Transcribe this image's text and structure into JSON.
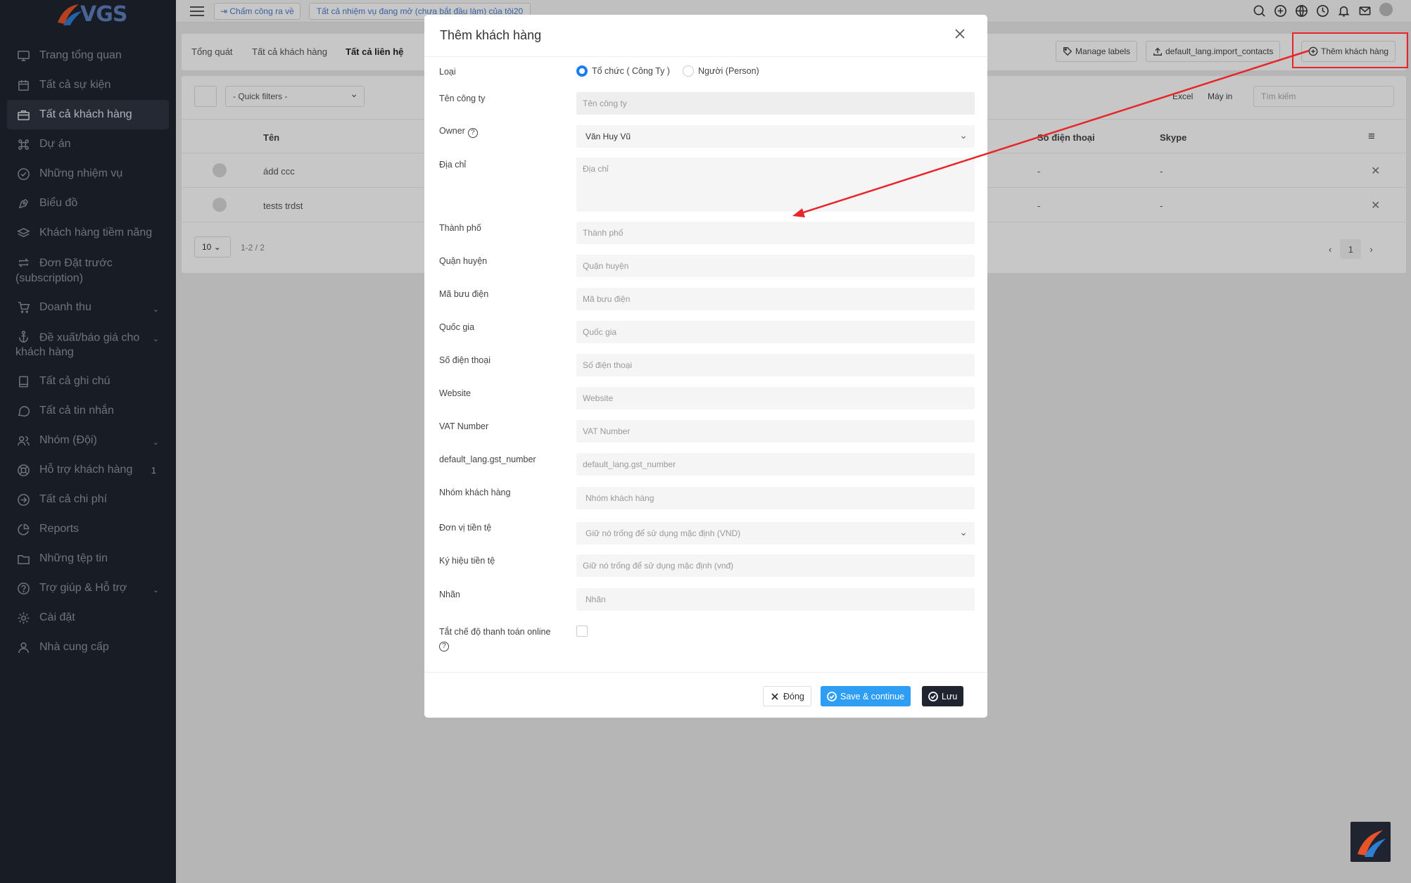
{
  "app": {
    "logo_text": "VGS"
  },
  "sidebar": {
    "items": [
      {
        "label": "Trang tổng quan",
        "icon": "monitor-icon"
      },
      {
        "label": "Tất cả sự kiện",
        "icon": "calendar-icon"
      },
      {
        "label": "Tất cả khách hàng",
        "icon": "briefcase-icon",
        "active": true
      },
      {
        "label": "Dự án",
        "icon": "command-icon"
      },
      {
        "label": "Những nhiệm vụ",
        "icon": "check-circle-icon"
      },
      {
        "label": "Biểu đồ",
        "icon": "pen-tool-icon"
      },
      {
        "label": "Khách hàng tiềm năng",
        "icon": "layers-icon"
      },
      {
        "label": "Đơn Đặt trước (subscription)",
        "icon": "repeat-icon"
      },
      {
        "label": "Doanh thu",
        "icon": "cart-icon",
        "chevron": true
      },
      {
        "label": "Đề xuất/báo giá cho khách hàng",
        "icon": "anchor-icon",
        "chevron": true
      },
      {
        "label": "Tất cả ghi chú",
        "icon": "book-icon"
      },
      {
        "label": "Tất cả tin nhắn",
        "icon": "message-circle-icon"
      },
      {
        "label": "Nhóm (Đội)",
        "icon": "users-icon",
        "chevron": true
      },
      {
        "label": "Hỗ trợ khách hàng",
        "icon": "life-buoy-icon",
        "badge": "1"
      },
      {
        "label": "Tất cả chi phí",
        "icon": "arrow-right-circle-icon"
      },
      {
        "label": "Reports",
        "icon": "pie-chart-icon"
      },
      {
        "label": "Những tệp tin",
        "icon": "folder-icon"
      },
      {
        "label": "Trợ giúp & Hỗ trợ",
        "icon": "help-circle-icon",
        "chevron": true
      },
      {
        "label": "Cài đặt",
        "icon": "settings-icon"
      },
      {
        "label": "Nhà cung cấp",
        "icon": "user-icon"
      }
    ]
  },
  "topbar": {
    "clock_out": "Chấm công ra về",
    "tasks_notice": "Tất cả nhiệm vụ đang mở (chưa bắt đầu làm) của tôi20"
  },
  "page": {
    "tabs": [
      "Tổng quát",
      "Tất cả khách hàng",
      "Tất cả liên hệ"
    ],
    "active_tab": "Tất cả liên hệ",
    "manage_labels": "Manage labels",
    "import_contacts": "default_lang.import_contacts",
    "add_client": "Thêm khách hàng",
    "quick_filters": "- Quick filters -",
    "excel": "Excel",
    "print": "Máy in",
    "search_placeholder": "Tìm kiếm",
    "columns": {
      "name": "Tên",
      "phone": "Số điện thoại",
      "skype": "Skype"
    },
    "rows": [
      {
        "name": "ádd ccc",
        "phone": "-",
        "skype": "-"
      },
      {
        "name": "tests trdst",
        "phone": "-",
        "skype": "-"
      }
    ],
    "page_size": "10",
    "range": "1-2 / 2",
    "current_page": "1"
  },
  "modal": {
    "title": "Thêm khách hàng",
    "type_label": "Loại",
    "type_org": "Tổ chức ( Công Ty )",
    "type_person": "Người (Person)",
    "company_label": "Tên công ty",
    "company_placeholder": "Tên công ty",
    "owner_label": "Owner",
    "owner_value": "Văn Huy Vũ",
    "address_label": "Địa chỉ",
    "address_placeholder": "Địa chỉ",
    "city_label": "Thành phố",
    "city_placeholder": "Thành phố",
    "district_label": "Quận huyện",
    "district_placeholder": "Quận huyện",
    "zip_label": "Mã bưu điện",
    "zip_placeholder": "Mã bưu điện",
    "country_label": "Quốc gia",
    "country_placeholder": "Quốc gia",
    "phone_label": "Số điện thoại",
    "phone_placeholder": "Số điện thoại",
    "website_label": "Website",
    "website_placeholder": "Website",
    "vat_label": "VAT Number",
    "vat_placeholder": "VAT Number",
    "gst_label": "default_lang.gst_number",
    "gst_placeholder": "default_lang.gst_number",
    "group_label": "Nhóm khách hàng",
    "group_placeholder": "Nhóm khách hàng",
    "currency_label": "Đơn vị tiền tệ",
    "currency_placeholder": "Giữ nó trống để sử dụng mặc định (VND)",
    "currency_symbol_label": "Ký hiệu tiền tệ",
    "currency_symbol_placeholder": "Giữ nó trống để sử dụng mặc định (vnđ)",
    "labels_label": "Nhãn",
    "labels_placeholder": "Nhãn",
    "disable_online_payment_label": "Tắt chế độ thanh toán online",
    "close_btn": "Đóng",
    "save_continue_btn": "Save & continue",
    "save_btn": "Lưu"
  },
  "annotation": {
    "color": "#e8262a"
  }
}
